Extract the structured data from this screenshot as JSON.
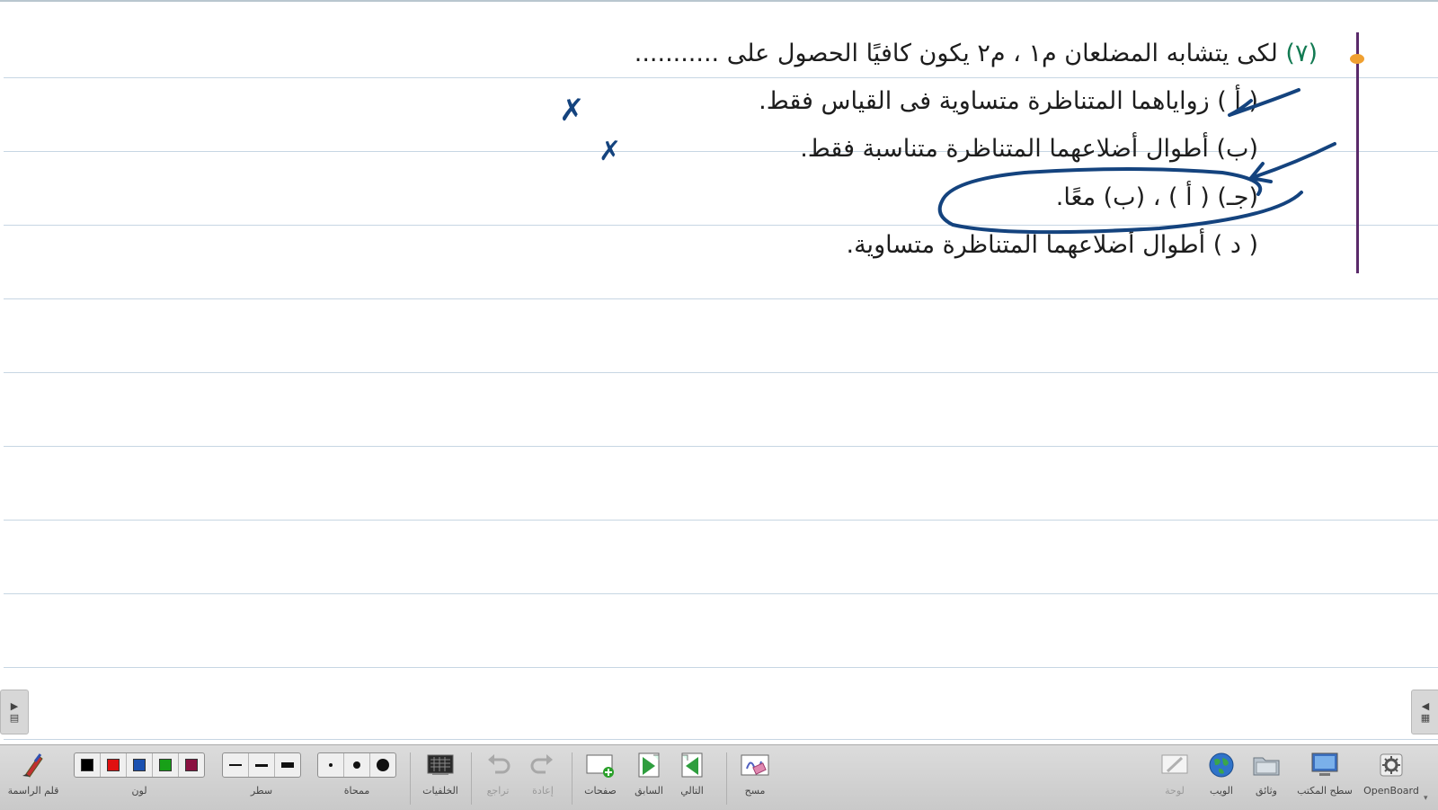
{
  "question": {
    "number": "(٧)",
    "stem": "لكى يتشابه المضلعان م١ ، م٢ يكون كافيًا الحصول على ...........",
    "options": [
      "( أ ) زواياهما المتناظرة متساوية فى القياس فقط.",
      "(ب) أطوال أضلاعهما المتناظرة متناسبة فقط.",
      "(جـ) ( أ ) ، (ب) معًا.",
      "( د ) أطوال أضلاعهما المتناظرة متساوية."
    ],
    "marks": {
      "wrong_a": "✗",
      "wrong_b": "✗"
    }
  },
  "colors": {
    "ink": "#14437e",
    "number": "#127a52",
    "margin_line": "#5a2a6a",
    "margin_dot": "#f0a030"
  },
  "toolbar": {
    "left": [
      {
        "id": "pen",
        "label": "قلم الراسمة",
        "icon": "pen-icon"
      },
      {
        "id": "color",
        "label": "لون",
        "swatches": [
          "#000000",
          "#e01010",
          "#1a50b0",
          "#18a018",
          "#8a1040"
        ]
      },
      {
        "id": "line",
        "label": "سطر",
        "icon": "line-width-icon"
      },
      {
        "id": "eraser",
        "label": "ممحاة",
        "icon": "eraser-size-icon"
      },
      {
        "id": "backgrounds",
        "label": "الخلفيات",
        "icon": "backgrounds-icon"
      },
      {
        "id": "undo",
        "label": "تراجع",
        "icon": "undo-icon"
      },
      {
        "id": "redo",
        "label": "إعادة",
        "icon": "redo-icon"
      },
      {
        "id": "pages",
        "label": "صفحات",
        "icon": "add-page-icon"
      },
      {
        "id": "previous",
        "label": "السابق",
        "icon": "previous-page-icon"
      },
      {
        "id": "next",
        "label": "التالي",
        "icon": "next-page-icon"
      },
      {
        "id": "clear",
        "label": "مسح",
        "icon": "clear-page-icon"
      }
    ],
    "right": [
      {
        "id": "board",
        "label": "لوحة",
        "icon": "board-icon"
      },
      {
        "id": "web",
        "label": "الويب",
        "icon": "globe-icon"
      },
      {
        "id": "documents",
        "label": "وثائق",
        "icon": "folder-icon"
      },
      {
        "id": "desktop",
        "label": "سطح المكتب",
        "icon": "desktop-icon"
      },
      {
        "id": "app",
        "label": "OpenBoard",
        "icon": "gear-icon"
      }
    ]
  }
}
